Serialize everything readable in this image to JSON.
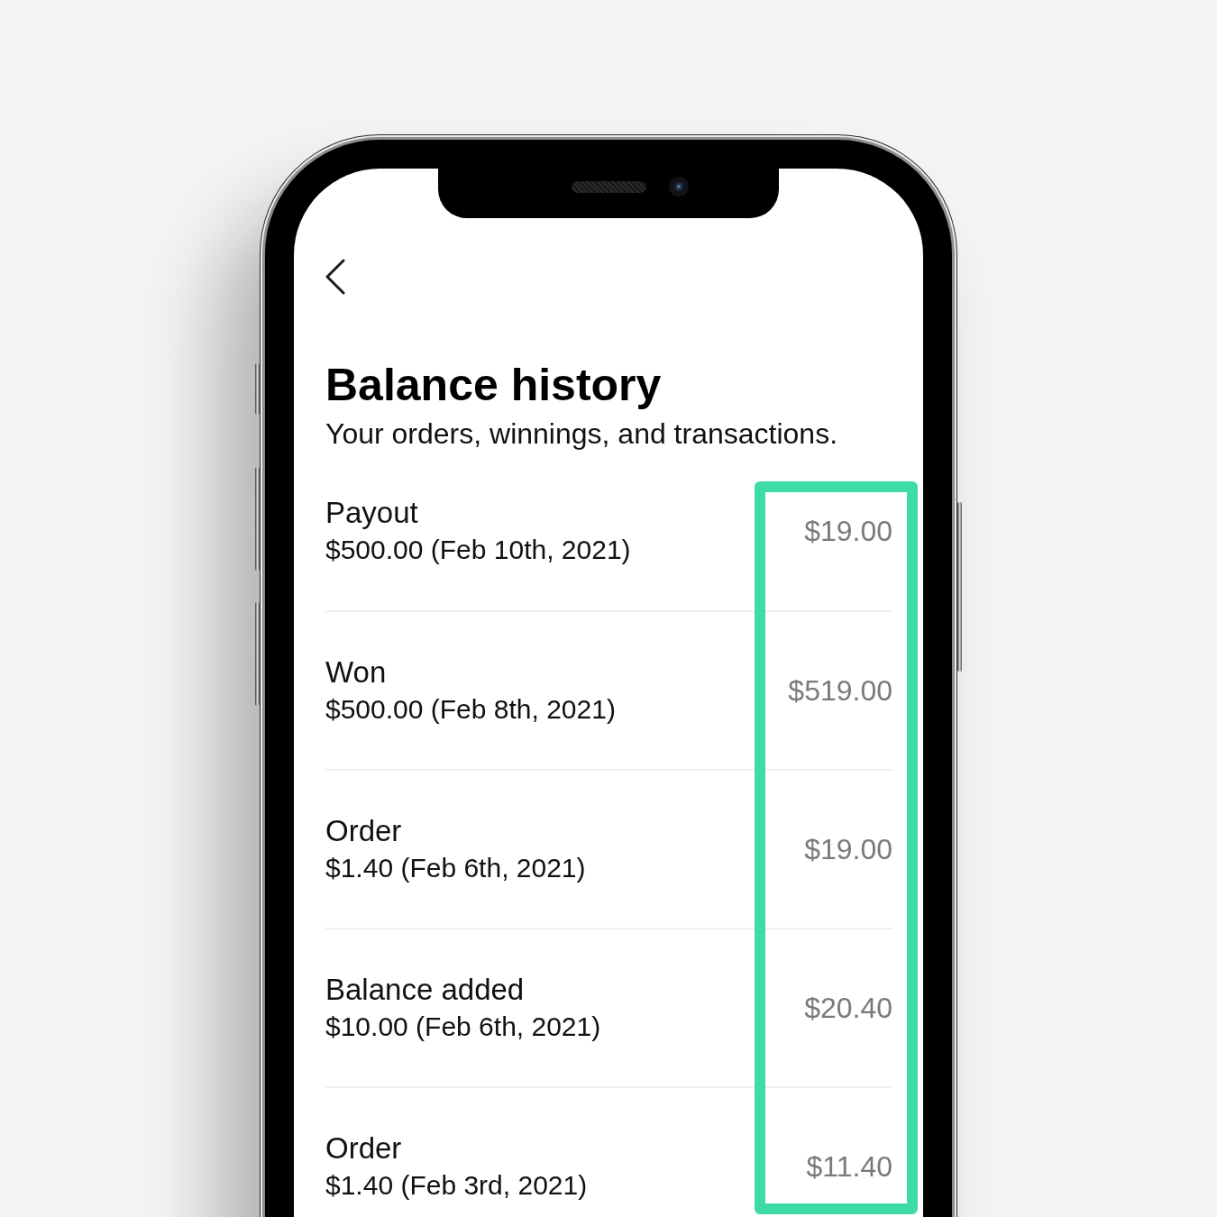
{
  "header": {
    "title": "Balance history",
    "subtitle": "Your orders, winnings, and transactions."
  },
  "transactions": {
    "highlight_amounts": true,
    "items": [
      {
        "type": "Payout",
        "detail": "$500.00 (Feb 10th, 2021)",
        "balance": "$19.00"
      },
      {
        "type": "Won",
        "detail": "$500.00 (Feb 8th, 2021)",
        "balance": "$519.00"
      },
      {
        "type": "Order",
        "detail": "$1.40 (Feb 6th, 2021)",
        "balance": "$19.00"
      },
      {
        "type": "Balance added",
        "detail": "$10.00 (Feb 6th, 2021)",
        "balance": "$20.40"
      },
      {
        "type": "Order",
        "detail": "$1.40 (Feb 3rd, 2021)",
        "balance": "$11.40"
      }
    ]
  }
}
